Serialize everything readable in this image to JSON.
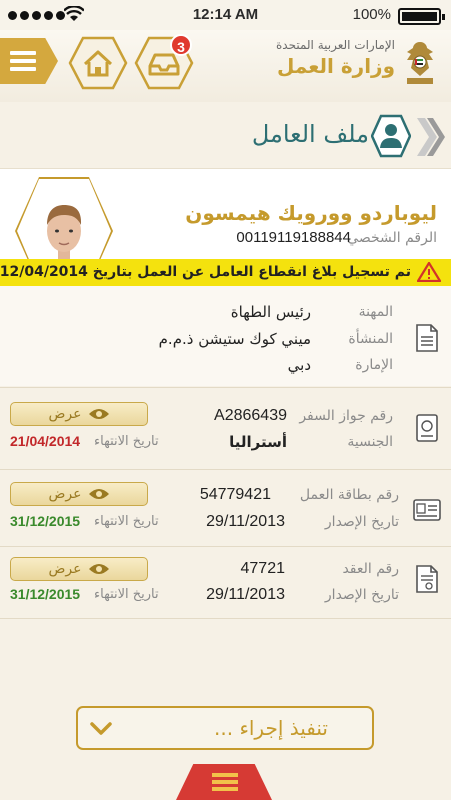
{
  "status_bar": {
    "time": "12:14 AM",
    "battery": "100%"
  },
  "header": {
    "badge_count": "3",
    "ministry_country": "الإمارات العربية المتحدة",
    "ministry_name": "وزارة العمل"
  },
  "page": {
    "title": "ملف العامل"
  },
  "worker": {
    "name": "ليوباردو وورويك هيمسون",
    "personal_id_label": "الرقم الشخصي",
    "personal_id": "00119119188844"
  },
  "alert": {
    "text": "تم تسجيل بلاغ انقطاع العامل عن العمل بتاريخ 12/04/2014"
  },
  "employment": {
    "profession_label": "المهنة",
    "profession": "رئيس الطهاة",
    "establishment_label": "المنشأة",
    "establishment": "ميني كوك ستيشن ذ.م.م",
    "emirate_label": "الإمارة",
    "emirate": "دبي"
  },
  "passport": {
    "number_label": "رقم جواز السفر",
    "number": "A2866439",
    "nationality_label": "الجنسية",
    "nationality": "أستراليا",
    "expiry_label": "تاريخ الانتهاء",
    "expiry": "21/04/2014",
    "view_label": "عرض"
  },
  "work_card": {
    "number_label": "رقم بطاقة العمل",
    "number": "54779421",
    "issue_label": "تاريخ الإصدار",
    "issue": "29/11/2013",
    "expiry_label": "تاريخ الانتهاء",
    "expiry": "31/12/2015",
    "view_label": "عرض"
  },
  "contract": {
    "number_label": "رقم العقد",
    "number": "47721",
    "issue_label": "تاريخ الإصدار",
    "issue": "29/11/2013",
    "expiry_label": "تاريخ الانتهاء",
    "expiry": "31/12/2015",
    "view_label": "عرض"
  },
  "action": {
    "label": "تنفيذ إجراء ..."
  },
  "colors": {
    "gold": "#c59a2c",
    "teal": "#2d6f73",
    "alert": "#f4e20e",
    "expired": "#c2282a",
    "valid": "#3a8a2c"
  },
  "icons": [
    "menu-icon",
    "home-icon",
    "inbox-icon",
    "uae-emblem",
    "worker-icon",
    "back-chevron-icon",
    "warning-icon",
    "document-icon",
    "passport-icon",
    "id-card-icon",
    "contract-icon",
    "eye-icon",
    "chevron-down-icon"
  ]
}
